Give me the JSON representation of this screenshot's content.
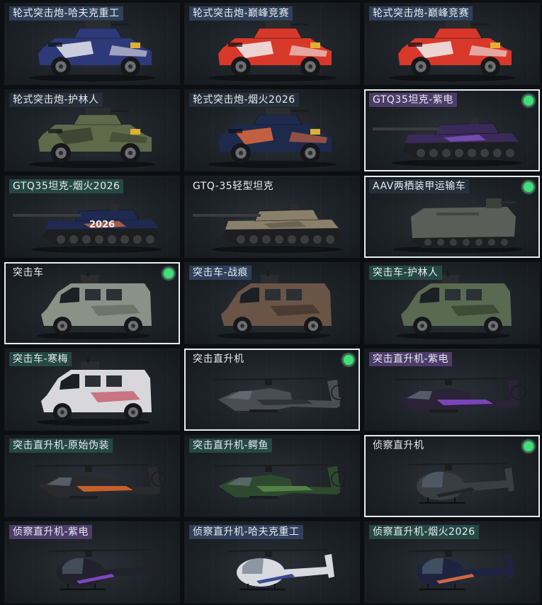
{
  "cards": [
    {
      "label": "轮式突击炮-哈夫克重工",
      "kind": "wheeled",
      "body": "#2d3a7a",
      "accent": "#e8e8ee",
      "tag": "blue",
      "selected": false,
      "equipped": false
    },
    {
      "label": "轮式突击炮-巅峰竞赛",
      "kind": "wheeled",
      "body": "#d8382a",
      "accent": "#f0f0f0",
      "tag": "blue",
      "selected": false,
      "equipped": false
    },
    {
      "label": "轮式突击炮-巅峰竞赛",
      "kind": "wheeled",
      "body": "#d8382a",
      "accent": "#f0f0f0",
      "tag": "blue",
      "selected": false,
      "equipped": false
    },
    {
      "label": "轮式突击炮-护林人",
      "kind": "wheeled",
      "body": "#5f6a4a",
      "accent": "#3a4030",
      "tag": "default",
      "selected": false,
      "equipped": false
    },
    {
      "label": "轮式突击炮-烟火2026",
      "kind": "wheeled",
      "body": "#1e2a4c",
      "accent": "#e06a40",
      "tag": "default",
      "selected": false,
      "equipped": false
    },
    {
      "label": "GTQ35坦克-紫电",
      "kind": "tank",
      "body": "#3a2a5a",
      "accent": "#8a5ad0",
      "tag": "purple",
      "selected": true,
      "equipped": true
    },
    {
      "label": "GTQ35坦克-烟火2026",
      "kind": "tank",
      "body": "#1e2a50",
      "accent": "#e07040",
      "tag": "teal",
      "selected": false,
      "equipped": false
    },
    {
      "label": "GTQ-35轻型坦克",
      "kind": "tank",
      "body": "#8a806a",
      "accent": "#5e5646",
      "tag": "plain",
      "selected": false,
      "equipped": false
    },
    {
      "label": "AAV两栖装甲运输车",
      "kind": "aav",
      "body": "#5a5e58",
      "accent": "#3c403a",
      "tag": "default",
      "selected": true,
      "equipped": true
    },
    {
      "label": "突击车",
      "kind": "mrap",
      "body": "#8a9288",
      "accent": "#5e665c",
      "tag": "plain",
      "selected": true,
      "equipped": true
    },
    {
      "label": "突击车-战痕",
      "kind": "mrap",
      "body": "#6a5446",
      "accent": "#3a2e28",
      "tag": "blue",
      "selected": false,
      "equipped": false
    },
    {
      "label": "突击车-护林人",
      "kind": "mrap",
      "body": "#5a6a50",
      "accent": "#2e3a2a",
      "tag": "teal",
      "selected": false,
      "equipped": false
    },
    {
      "label": "突击车-寒梅",
      "kind": "mrap",
      "body": "#d8d8dc",
      "accent": "#c04050",
      "tag": "teal",
      "selected": false,
      "equipped": false
    },
    {
      "label": "突击直升机",
      "kind": "attack-heli",
      "body": "#4a4e52",
      "accent": "#2a2e32",
      "tag": "plain",
      "selected": true,
      "equipped": true
    },
    {
      "label": "突击直升机-紫电",
      "kind": "attack-heli",
      "body": "#2a2236",
      "accent": "#8a4ad0",
      "tag": "purple",
      "selected": false,
      "equipped": false
    },
    {
      "label": "突击直升机-原始伪装",
      "kind": "attack-heli",
      "body": "#2a2a2e",
      "accent": "#e06a2a",
      "tag": "teal",
      "selected": false,
      "equipped": false
    },
    {
      "label": "突击直升机-鳄鱼",
      "kind": "attack-heli",
      "body": "#2e4a2e",
      "accent": "#5a8a4a",
      "tag": "teal",
      "selected": false,
      "equipped": false
    },
    {
      "label": "侦察直升机",
      "kind": "scout-heli",
      "body": "#3a3e42",
      "accent": "#1e2226",
      "tag": "plain",
      "selected": true,
      "equipped": true
    },
    {
      "label": "侦察直升机-紫电",
      "kind": "scout-heli",
      "body": "#22222c",
      "accent": "#8a4ad0",
      "tag": "purple",
      "selected": false,
      "equipped": false
    },
    {
      "label": "侦察直升机-哈夫克重工",
      "kind": "scout-heli",
      "body": "#d8dae0",
      "accent": "#2a3a8a",
      "tag": "blue",
      "selected": false,
      "equipped": false
    },
    {
      "label": "侦察直升机-烟火2026",
      "kind": "scout-heli",
      "body": "#1e2440",
      "accent": "#e07040",
      "tag": "teal",
      "selected": false,
      "equipped": false
    }
  ],
  "tank_decal_text": "2026",
  "colors": {
    "equipped_dot": "#3fe07a",
    "selected_border": "#e8ecef",
    "background": "#0c0f12"
  }
}
